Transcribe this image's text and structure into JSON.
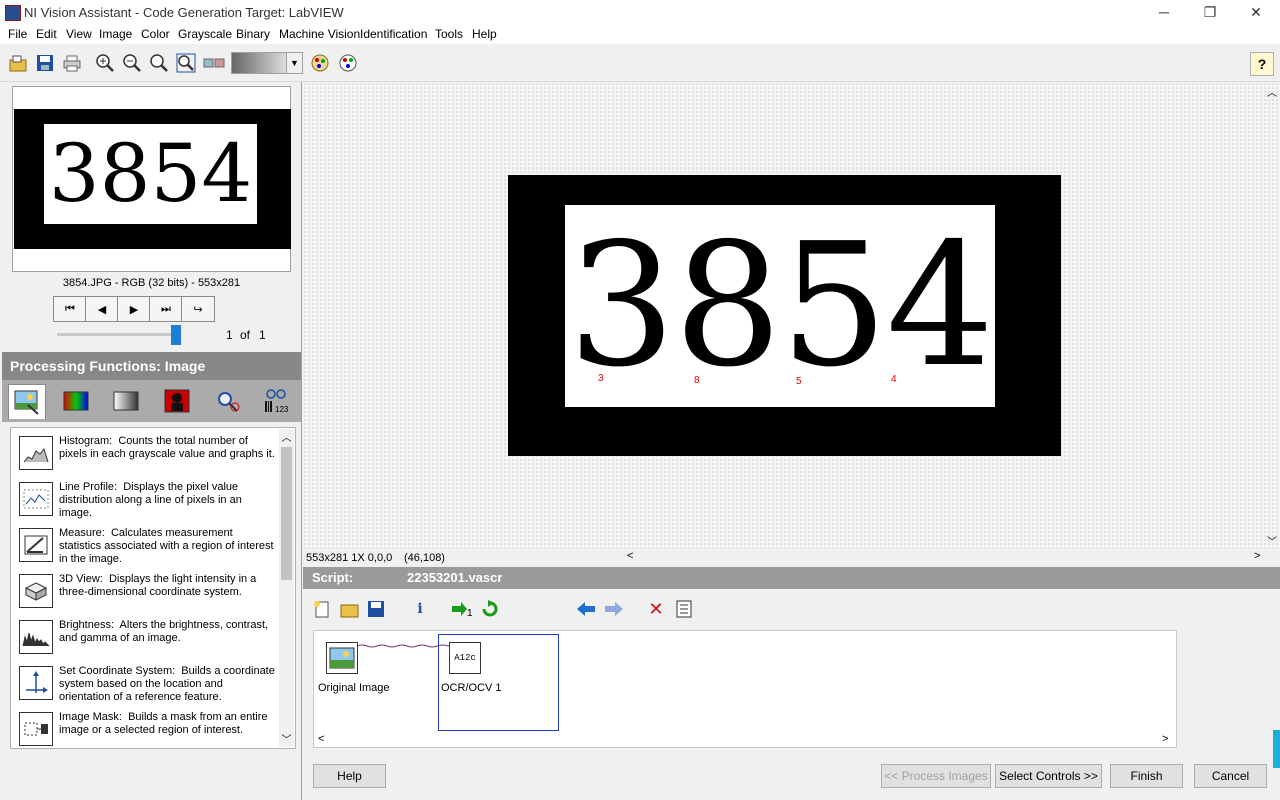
{
  "window": {
    "title": "NI Vision Assistant - Code Generation Target: LabVIEW",
    "minimize": "─",
    "restore": "❐",
    "close": "✕"
  },
  "menu": [
    "File",
    "Edit",
    "View",
    "Image",
    "Color",
    "Grayscale",
    "Binary",
    "Machine Vision",
    "Identification",
    "Tools",
    "Help"
  ],
  "toolbar": {
    "help_icon": "?"
  },
  "thumbnail": {
    "number": "3854",
    "info": "3854.JPG - RGB (32 bits) - 553x281",
    "page_current": "1",
    "page_of": "of",
    "page_total": "1",
    "slider_position": 1.0
  },
  "processing": {
    "header": "Processing Functions: Image",
    "functions": [
      {
        "name": "Histogram:",
        "desc": "Counts the total number of pixels in each grayscale value and graphs it."
      },
      {
        "name": "Line Profile:",
        "desc": "Displays the pixel value distribution along a line of pixels in an image."
      },
      {
        "name": "Measure:",
        "desc": "Calculates measurement statistics associated with a region of interest in the image."
      },
      {
        "name": "3D View:",
        "desc": "Displays the light intensity in a three-dimensional coordinate system."
      },
      {
        "name": "Brightness:",
        "desc": "Alters the brightness, contrast, and gamma of an image."
      },
      {
        "name": "Set Coordinate System:",
        "desc": "Builds a coordinate system based on the location and orientation of a reference feature."
      },
      {
        "name": "Image Mask:",
        "desc": "Builds a mask from an entire image or a selected region of interest."
      }
    ]
  },
  "viewer": {
    "number": "3854",
    "ocr_labels": [
      "3",
      "8",
      "5",
      "4"
    ],
    "status_size": "553x281 1X 0,0,0",
    "status_coord": "(46,108)"
  },
  "script": {
    "label": "Script:",
    "filename": "22353201.vascr",
    "steps": [
      {
        "label": "Original Image"
      },
      {
        "label": "OCR/OCV 1",
        "icon_text": "A12c"
      }
    ]
  },
  "buttons": {
    "help": "Help",
    "process_images": "<< Process Images",
    "select_controls": "Select Controls >>",
    "finish": "Finish",
    "cancel": "Cancel"
  }
}
